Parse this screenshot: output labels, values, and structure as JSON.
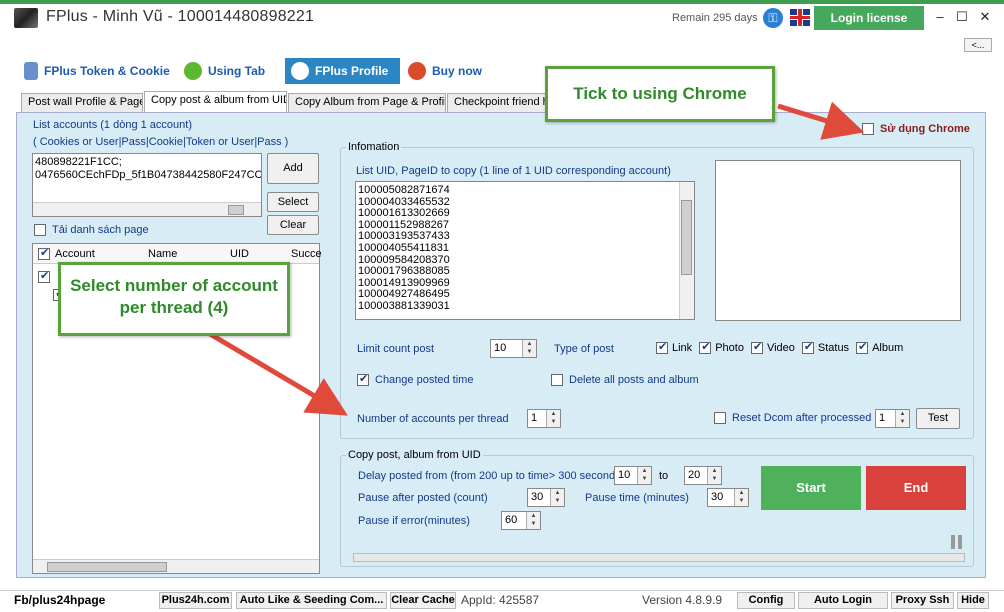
{
  "app": {
    "title": "FPlus - Minh Vũ - 100014480898221",
    "remain": "Remain 295 days",
    "login_label": "Login license",
    "back_label": "<...",
    "minimize": "–",
    "maximize": "☐",
    "close": "✕"
  },
  "nav": [
    {
      "label": "FPlus Token & Cookie"
    },
    {
      "label": "Using Tab"
    },
    {
      "label": "FPlus Profile"
    },
    {
      "label": "Buy now"
    }
  ],
  "tabs": [
    {
      "label": "Post wall Profile & Page"
    },
    {
      "label": "Copy post & album from UID"
    },
    {
      "label": "Copy Album from Page & Profile"
    },
    {
      "label": "Checkpoint friend h"
    }
  ],
  "left": {
    "list_label": "List accounts (1 dòng 1 account)",
    "format_label": "( Cookies or User|Pass|Cookie|Token or User|Pass )",
    "accounts_text": "480898221F1CC;\n0476560CEchFDp_5f1B04738442580F247CC;",
    "add": "Add",
    "select": "Select",
    "clear": "Clear",
    "load_page_label": "Tải danh sách page",
    "table_headers": [
      "Account",
      "Name",
      "UID",
      "Succe"
    ]
  },
  "info": {
    "group_title": "Infomation",
    "uid_label": "List UID, PageID to copy (1 line of 1 UID corresponding account)",
    "uids": [
      "100005082871674",
      "100004033465532",
      "100001613302669",
      "100001152988267",
      "100003193537433",
      "100004055411831",
      "100009584208370",
      "100001796388085",
      "100014913909969",
      "100004927486495",
      "100003881339031"
    ],
    "limit_label": "Limit count post",
    "limit_value": "10",
    "type_label": "Type of post",
    "types": [
      {
        "label": "Link",
        "checked": true
      },
      {
        "label": "Photo",
        "checked": true
      },
      {
        "label": "Video",
        "checked": true
      },
      {
        "label": "Status",
        "checked": true
      },
      {
        "label": "Album",
        "checked": true
      }
    ],
    "change_time_label": "Change posted time",
    "delete_all_label": "Delete all posts and album",
    "accounts_thread_label": "Number of accounts per thread",
    "accounts_thread_value": "1",
    "reset_dcom_label": "Reset Dcom after processed",
    "reset_dcom_value": "1",
    "test": "Test"
  },
  "chrome": {
    "label": "Sử dụng Chrome"
  },
  "copy": {
    "group_title": "Copy post, album from UID",
    "delay_label": "Delay posted from (from 200 up to time> 300 seconds)",
    "delay_from": "10",
    "to_label": "to",
    "delay_to": "20",
    "pause_after_label": "Pause after posted (count)",
    "pause_after_value": "30",
    "pause_time_label": "Pause time (minutes)",
    "pause_time_value": "30",
    "pause_error_label": "Pause if error(minutes)",
    "pause_error_value": "60",
    "start": "Start",
    "end": "End"
  },
  "callouts": {
    "chrome": "Tick to using Chrome",
    "thread": "Select number of account per thread (4)"
  },
  "status": {
    "page": "Fb/plus24hpage",
    "plus24h": "Plus24h.com",
    "auto_like": "Auto Like & Seeding Com...",
    "clear_cache": "Clear Cache",
    "appid": "AppId: 425587",
    "version": "Version 4.8.9.9",
    "config": "Config",
    "auto_login": "Auto Login",
    "proxy": "Proxy Ssh",
    "hide": "Hide"
  },
  "colors": {
    "accent": "#2b86c5",
    "start": "#4fb15c",
    "end": "#d9413d",
    "login": "#45a85c"
  }
}
